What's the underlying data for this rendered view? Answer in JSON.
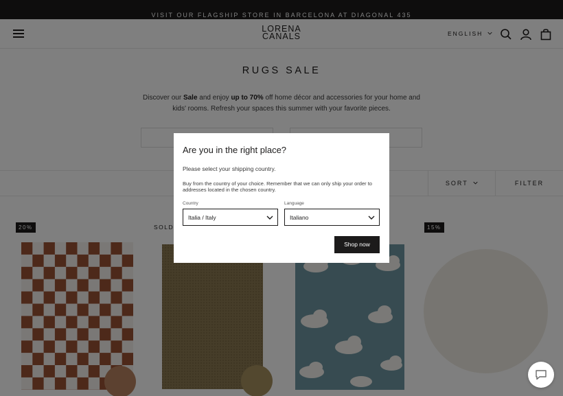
{
  "announcement": "VISIT OUR FLAGSHIP STORE IN BARCELONA AT DIAGONAL 435",
  "header": {
    "logo_line1": "LORENA",
    "logo_line2": "CANALS",
    "language": "ENGLISH"
  },
  "collection": {
    "title": "RUGS SALE",
    "intro_1": "Discover our ",
    "intro_2": "Sale",
    "intro_3": " and enjoy ",
    "intro_4": "up to 70%",
    "intro_5": " off home décor and accessories for your home and kids' rooms. Refresh your spaces this summer with your favorite pieces."
  },
  "toolbar": {
    "sort": "SORT",
    "filter": "FILTER"
  },
  "badges": {
    "p1": "20%",
    "p2": "SOLD",
    "p4": "15%"
  },
  "modal": {
    "title": "Are you in the right place?",
    "subtitle": "Please select your shipping country.",
    "info": "Buy from the country of your choice. Remember that we can only ship your order to addresses located in the chosen country.",
    "country_label": "Country",
    "country_value": "Italia / Italy",
    "language_label": "Language",
    "language_value": "Italiano",
    "cta": "Shop now"
  },
  "colors": {
    "ink": "#1c1b1b",
    "checker_brown": "#9b5234",
    "jute": "#8d7b52",
    "cloud_blue": "#6f97a2",
    "round_ivory": "#efebe2"
  }
}
